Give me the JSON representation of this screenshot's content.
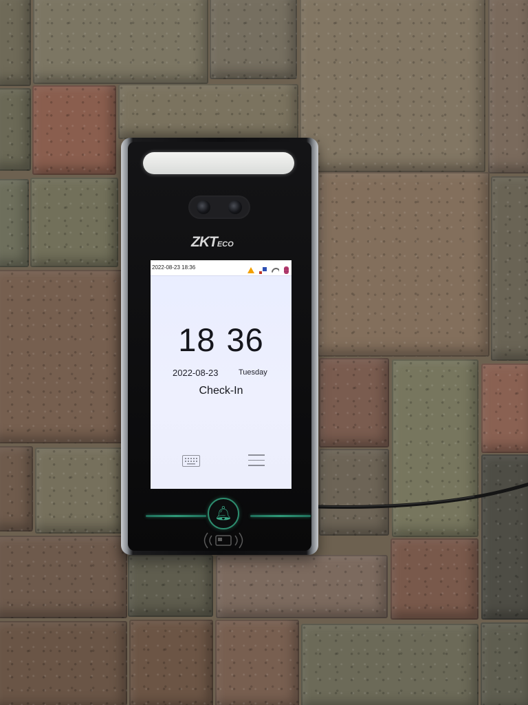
{
  "device": {
    "brand_main": "ZKT",
    "brand_sub": "ECO",
    "status_bar": {
      "datetime": "2022-08-23 18:36",
      "icons": [
        "warning-icon",
        "network-icon",
        "wifi-icon",
        "database-icon"
      ]
    },
    "clock": "18 36",
    "date": "2022-08-23",
    "weekday": "Tuesday",
    "mode": "Check-In",
    "buttons": [
      "keyboard-icon",
      "menu-icon",
      "bell-icon"
    ],
    "colors": {
      "screen_bg": "#eceefc",
      "accent_green": "#2f9a78",
      "warning": "#f2a000"
    }
  }
}
